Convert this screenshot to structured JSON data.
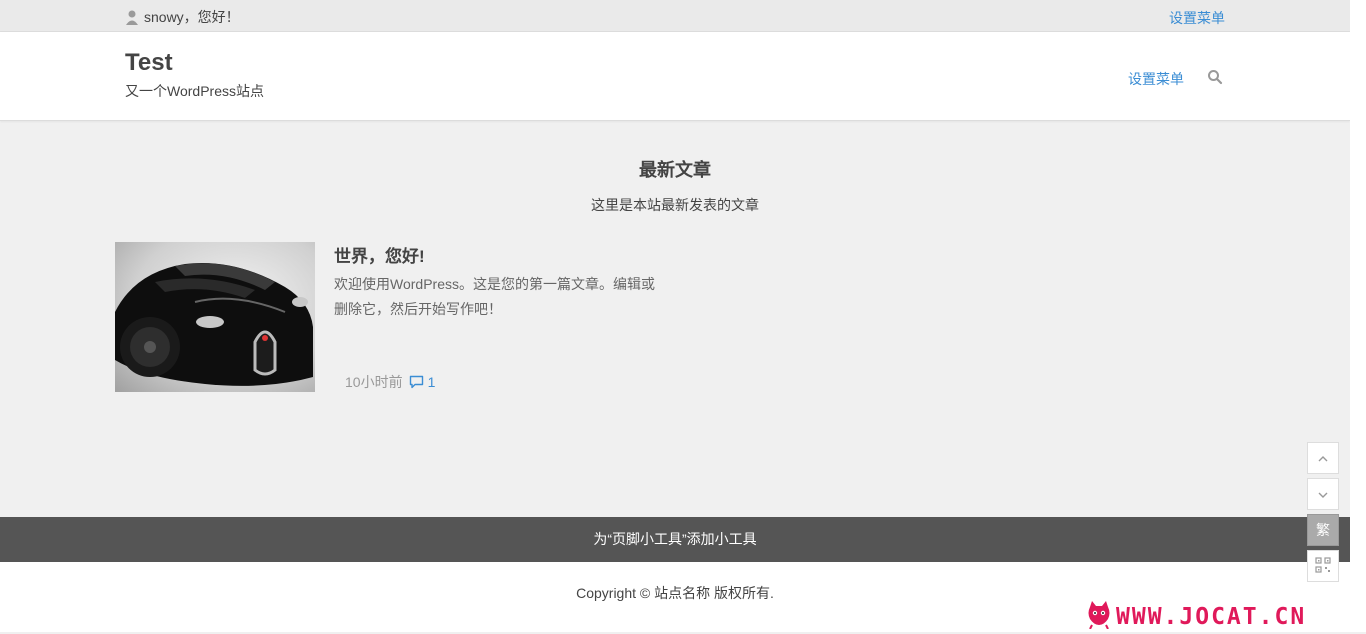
{
  "topbar": {
    "greeting": "snowy，您好！",
    "menu_label": "设置菜单"
  },
  "header": {
    "site_title": "Test",
    "site_description": "又一个WordPress站点",
    "nav_label": "设置菜单",
    "search_icon": "search-icon"
  },
  "main": {
    "section_title": "最新文章",
    "section_subtitle": "这里是本站最新发表的文章",
    "posts": [
      {
        "title": "世界，您好!",
        "excerpt_line1": "欢迎使用WordPress。这是您的第一篇文章。编辑或",
        "excerpt_line2": "删除它，然后开始写作吧！",
        "time": "10小时前",
        "comments": "1"
      }
    ]
  },
  "footer": {
    "widget_text": "为“页脚小工具”添加小工具",
    "copyright": "Copyright ©   站点名称   版权所有."
  },
  "tools": {
    "traditional_label": "繁"
  },
  "watermark": {
    "text": "WWW.JOCAT.CN"
  },
  "colors": {
    "link": "#3b8dd4",
    "footer_bg": "#555555",
    "watermark": "#e0195a"
  }
}
